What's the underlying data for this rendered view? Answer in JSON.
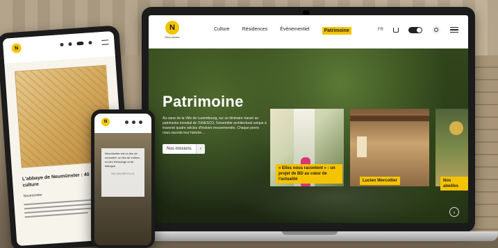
{
  "laptop": {
    "logo": {
      "mark": "N",
      "text": "Neumünster"
    },
    "menu": [
      {
        "label": "Culture",
        "active": false
      },
      {
        "label": "Résidences",
        "active": false
      },
      {
        "label": "Événementiel",
        "active": false
      },
      {
        "label": "Patrimoine",
        "active": true
      }
    ],
    "lang": "FR",
    "icons": [
      "cart-icon",
      "theme-toggle-icon",
      "search-icon",
      "menu-icon"
    ],
    "accent": "#f4c400",
    "hero": {
      "title": "Patrimoine",
      "description": "Au cœur de la Ville de Luxembourg, sur un itinéraire classé au patrimoine mondial de l'UNESCO, l'ensemble architectural unique à traversé quatre siècles d'histoire mouvementée. Chaque pierre nous raconte leur histoire…",
      "button": "Nos missions",
      "button_arrow": "›"
    },
    "cards": [
      {
        "label": "« Elles nous racontent » : un projet de BD au cœur de l'actualité"
      },
      {
        "label": "Lucien Wercollier"
      },
      {
        "label": "Nos abeilles"
      }
    ],
    "next": "›"
  },
  "tablet": {
    "logo": "N",
    "title": "L'abbaye de Neumünster : 40 ans de culture",
    "subtitle": "Neumünster"
  },
  "phone": {
    "logo": "N",
    "text": "Neumünster est un lieu de rencontre, un lieu de culture, un lieu d'échange et de dialogue.",
    "link": "EN SAVOIR PLUS"
  }
}
